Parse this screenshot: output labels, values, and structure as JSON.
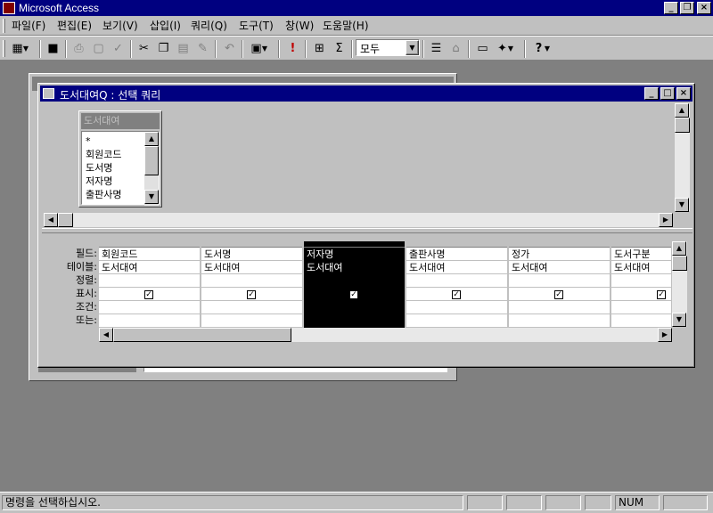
{
  "app": {
    "title": "Microsoft Access"
  },
  "menu": [
    "파일(F)",
    "편집(E)",
    "보기(V)",
    "삽입(I)",
    "쿼리(Q)",
    "도구(T)",
    "창(W)",
    "도움말(H)"
  ],
  "toolbar": {
    "icons": [
      "view-icon",
      "save-icon",
      "print-icon",
      "print-preview-icon",
      "spelling-icon",
      "cut-icon",
      "copy-icon",
      "paste-icon",
      "format-painter-icon",
      "undo-icon",
      "query-type-icon",
      "run-icon",
      "show-table-icon",
      "totals-icon",
      "properties-icon",
      "build-icon",
      "database-window-icon",
      "new-object-icon",
      "help-icon"
    ],
    "top_values": "모두"
  },
  "query_window": {
    "title": "도서대여Q : 선택 쿼리",
    "table": {
      "name": "도서대여",
      "fields": [
        "*",
        "회원코드",
        "도서명",
        "저자명",
        "출판사명"
      ]
    },
    "row_labels": [
      "필드:",
      "테이블:",
      "정렬:",
      "표시:",
      "조건:",
      "또는:"
    ],
    "columns": [
      {
        "field": "회원코드",
        "table": "도서대여",
        "sort": "",
        "show": true,
        "criteria": "",
        "or": ""
      },
      {
        "field": "도서명",
        "table": "도서대여",
        "sort": "",
        "show": true,
        "criteria": "",
        "or": ""
      },
      {
        "field": "저자명",
        "table": "도서대여",
        "sort": "",
        "show": true,
        "criteria": "",
        "or": "",
        "selected": true
      },
      {
        "field": "출판사명",
        "table": "도서대여",
        "sort": "",
        "show": true,
        "criteria": "",
        "or": ""
      },
      {
        "field": "정가",
        "table": "도서대여",
        "sort": "",
        "show": true,
        "criteria": "",
        "or": ""
      },
      {
        "field": "도서구분",
        "table": "도서대여",
        "sort": "",
        "show": true,
        "criteria": "",
        "or": ""
      }
    ]
  },
  "status": {
    "message": "명령을 선택하십시오.",
    "num": "NUM"
  },
  "colors": {
    "title_active": "#000080",
    "title_inactive": "#808080",
    "face": "#c0c0c0",
    "desktop": "#808080"
  }
}
